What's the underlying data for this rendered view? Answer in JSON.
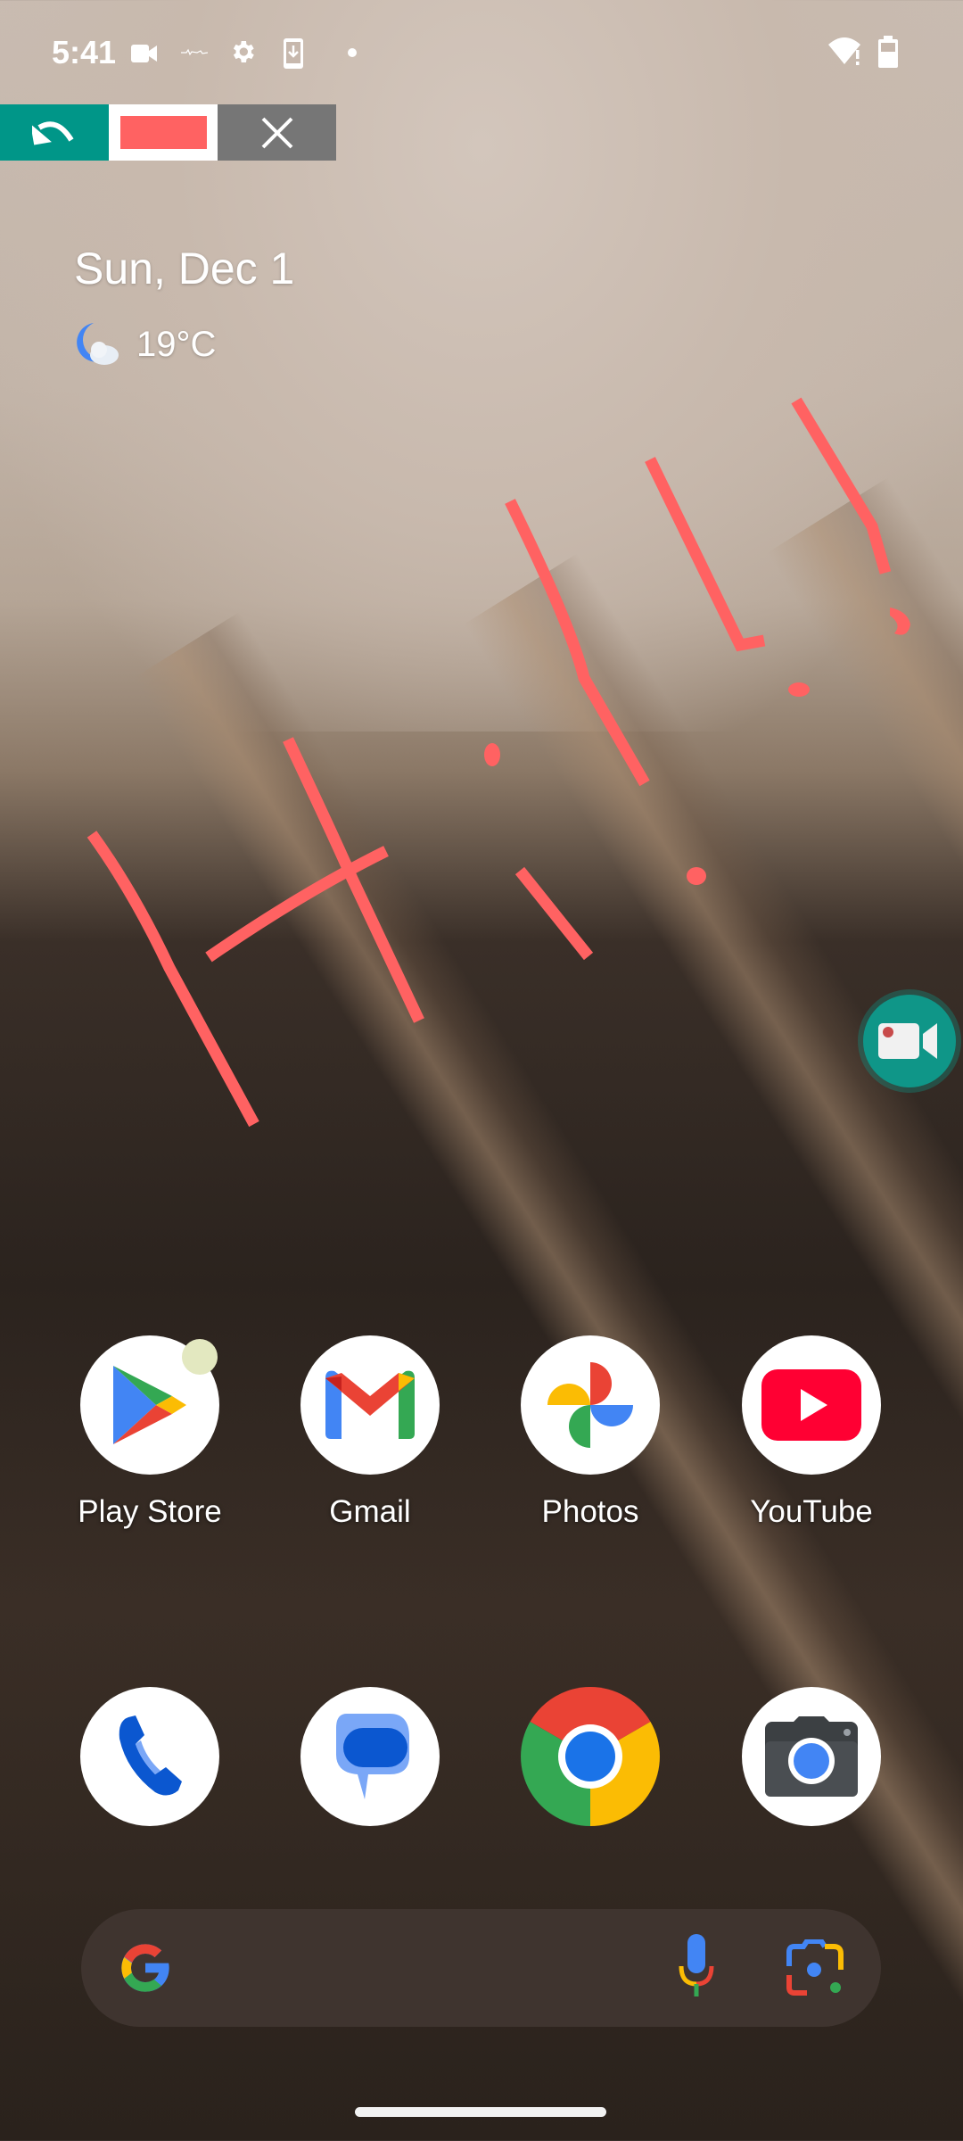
{
  "status_bar": {
    "time": "5:41",
    "icons": [
      "video-camera-icon",
      "signal-noise-icon",
      "settings-gear-icon",
      "phone-download-icon",
      "notification-dot-icon"
    ],
    "right_icons": [
      "wifi-alert-icon",
      "battery-icon"
    ]
  },
  "draw_toolbar": {
    "undo_icon": "undo-icon",
    "color_swatch": "#ff6262",
    "close_icon": "close-icon",
    "colors": {
      "undo_bg": "#009688",
      "close_bg": "#767676"
    }
  },
  "at_a_glance": {
    "date": "Sun, Dec 1",
    "weather_icon": "moon-cloud-icon",
    "temperature": "19°C"
  },
  "annotation": {
    "text": "Hi!!!",
    "stroke_color": "#ff6262"
  },
  "floating_record_button": {
    "icon": "video-record-icon",
    "color": "#0f9688"
  },
  "apps_row1": [
    {
      "label": "Play Store",
      "icon": "play-store-icon",
      "has_badge": true
    },
    {
      "label": "Gmail",
      "icon": "gmail-icon"
    },
    {
      "label": "Photos",
      "icon": "photos-icon"
    },
    {
      "label": "YouTube",
      "icon": "youtube-icon"
    }
  ],
  "dock": [
    {
      "name": "Phone",
      "icon": "phone-icon"
    },
    {
      "name": "Messages",
      "icon": "messages-icon"
    },
    {
      "name": "Chrome",
      "icon": "chrome-icon"
    },
    {
      "name": "Camera",
      "icon": "camera-icon"
    }
  ],
  "search_bar": {
    "logo": "google-g-icon",
    "mic_icon": "microphone-icon",
    "lens_icon": "google-lens-icon",
    "bg_color": "#3f342f"
  }
}
